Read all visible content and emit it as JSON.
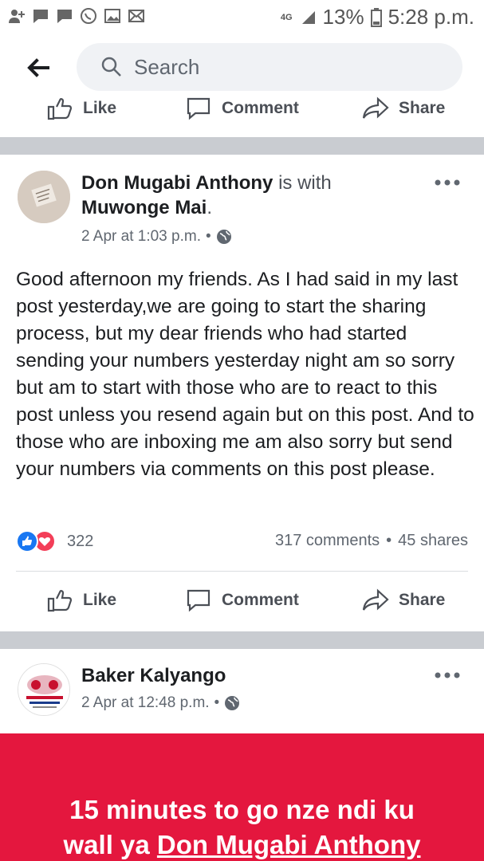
{
  "status_bar": {
    "network": "4G",
    "battery": "13%",
    "time": "5:28 p.m.",
    "icons": [
      "person-add-icon",
      "chat-icon",
      "chat-icon",
      "whatsapp-icon",
      "gallery-icon",
      "mail-icon"
    ]
  },
  "header": {
    "search_placeholder": "Search"
  },
  "actions": {
    "like": "Like",
    "comment": "Comment",
    "share": "Share"
  },
  "post1": {
    "author": "Don Mugabi Anthony",
    "connector": " is with",
    "tagged": "Muwonge Mai",
    "date": "2 Apr at 1:03 p.m.",
    "sep": "•",
    "text": "Good afternoon my friends. As I had said in my last post yesterday,we are going to start the sharing process, but my dear friends who had started sending your numbers yesterday night am so sorry but am to start with those who are to react to this post unless you resend again but on this post. And to those who are inboxing me am also sorry but send your numbers via comments on this post please.",
    "reaction_count": "322",
    "comments": "317 comments",
    "shares": "45 shares"
  },
  "post2": {
    "author": "Baker Kalyango",
    "date": "2 Apr at 12:48 p.m.",
    "sep": "•",
    "banner_line1": "15 minutes to go nze ndi ku",
    "banner_line2_prefix": "wall ya ",
    "banner_line2_link": "Don Mugabi Anthony"
  },
  "colors": {
    "accent": "#1877f2",
    "love": "#f33e58",
    "banner": "#e4173e",
    "divider": "#c9ccd1"
  }
}
